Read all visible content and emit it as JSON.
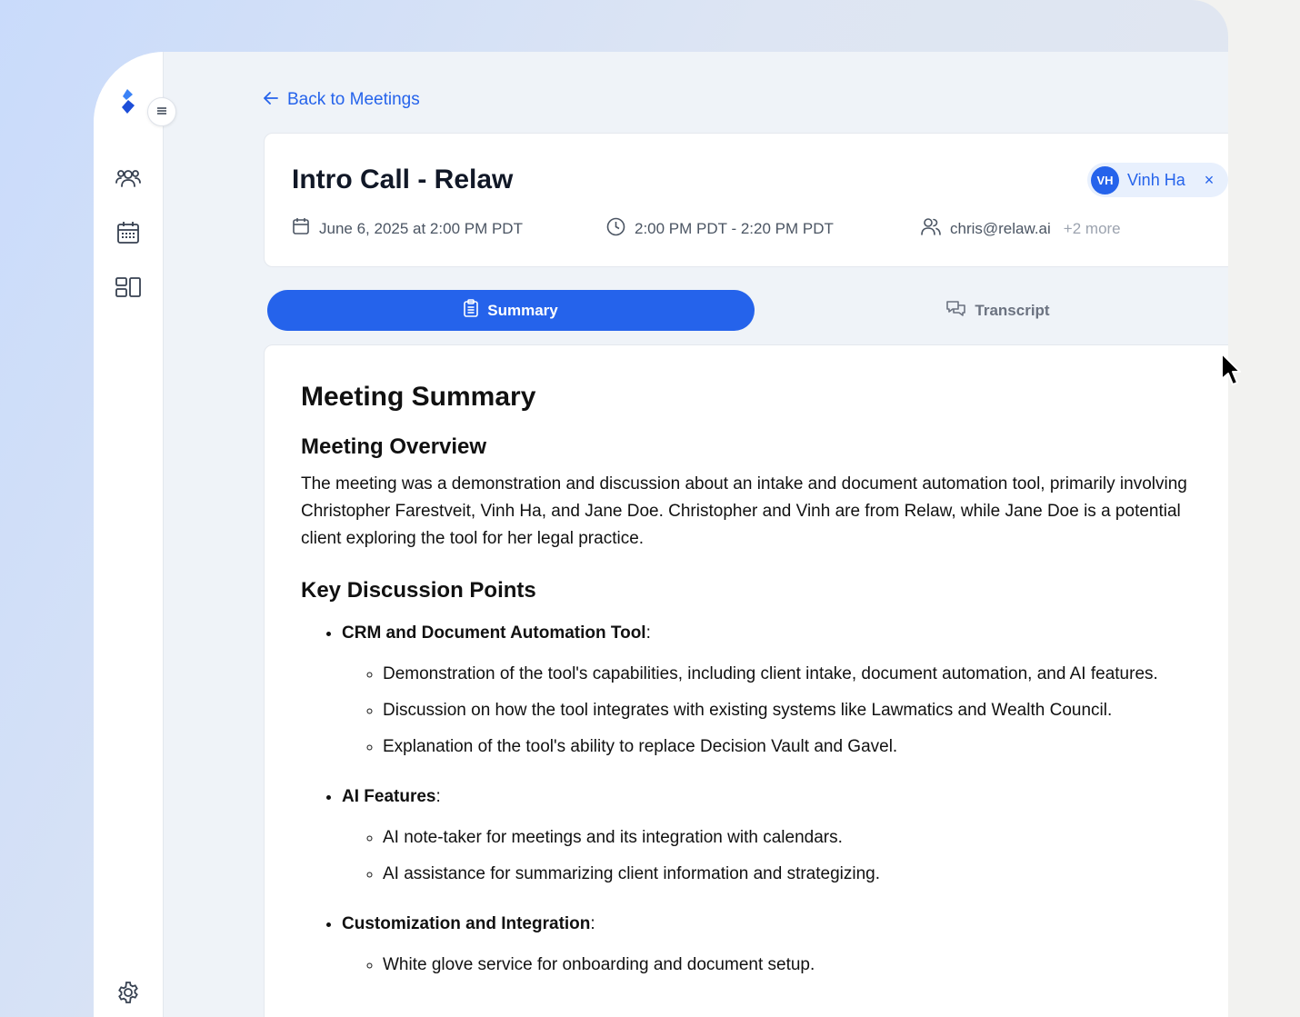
{
  "nav": {
    "back_label": "Back to Meetings"
  },
  "meeting": {
    "title": "Intro Call - Relaw",
    "date": "June 6, 2025 at 2:00 PM PDT",
    "time_range": "2:00 PM PDT - 2:20 PM PDT",
    "attendee": "chris@relaw.ai",
    "attendee_more": "+2 more",
    "owner_initials": "VH",
    "owner_name": "Vinh Ha",
    "remove_glyph": "×"
  },
  "tabs": {
    "summary": "Summary",
    "transcript": "Transcript",
    "active": "Summary"
  },
  "summary": {
    "heading": "Meeting Summary",
    "overview_heading": "Meeting Overview",
    "overview_text": "The meeting was a demonstration and discussion about an intake and document automation tool, primarily involving Christopher Farestveit, Vinh Ha, and Jane Doe. Christopher and Vinh are from Relaw, while Jane Doe is a potential client exploring the tool for her legal practice.",
    "points_heading": "Key Discussion Points",
    "points": [
      {
        "title": "CRM and Document Automation Tool",
        "items": [
          "Demonstration of the tool's capabilities, including client intake, document automation, and AI features.",
          "Discussion on how the tool integrates with existing systems like Lawmatics and Wealth Council.",
          "Explanation of the tool's ability to replace Decision Vault and Gavel."
        ]
      },
      {
        "title": "AI Features",
        "items": [
          "AI note-taker for meetings and its integration with calendars.",
          "AI assistance for summarizing client information and strategizing."
        ]
      },
      {
        "title": "Customization and Integration",
        "items": [
          "White glove service for onboarding and document setup."
        ]
      }
    ]
  },
  "colors": {
    "accent": "#2563eb",
    "text": "#111827",
    "muted": "#6b7280"
  },
  "icons": [
    "relaw-logo-icon",
    "menu-icon",
    "users-icon",
    "calendar-icon",
    "dashboard-icon",
    "settings-icon",
    "arrow-left-icon",
    "clock-icon",
    "clipboard-icon",
    "chat-icon",
    "close-icon",
    "cursor-icon"
  ]
}
